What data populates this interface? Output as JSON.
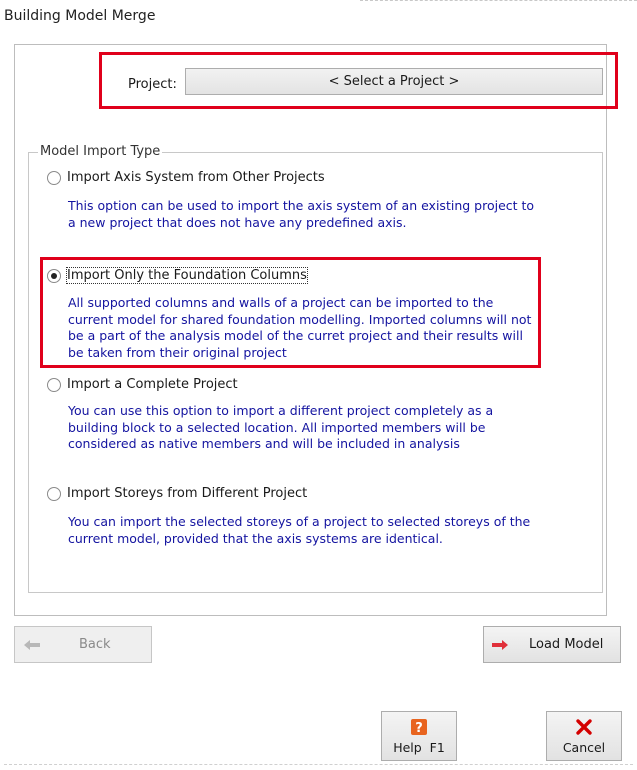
{
  "window": {
    "title": "Building Model Merge"
  },
  "project": {
    "label": "Project:",
    "button_text": "< Select a Project >"
  },
  "import_type": {
    "group_title": "Model Import Type",
    "options": [
      {
        "label": "Import Axis System from Other Projects",
        "selected": false,
        "description": "This option can be used to import the axis system of an existing project to a new project that does not have any predefined axis."
      },
      {
        "label": "Import Only the Foundation Columns",
        "selected": true,
        "description": "All supported columns and walls of a project can be imported to the current model for shared foundation modelling. Imported columns will not be a part of the analysis model of the curret project and their results will be taken from their original project"
      },
      {
        "label": "Import a Complete Project",
        "selected": false,
        "description": "You can use this option to import a different project completely as a building block to a selected location. All imported members will be considered as native members and will be included in analysis"
      },
      {
        "label": "Import Storeys from Different Project",
        "selected": false,
        "description": "You can import the selected storeys of a project to selected storeys of the current model, provided that the axis systems are identical."
      }
    ]
  },
  "nav": {
    "back_label": "Back",
    "back_enabled": false,
    "load_label": "Load Model"
  },
  "footer": {
    "help_label": "Help  F1",
    "cancel_label": "Cancel"
  },
  "colors": {
    "highlight": "#e0001b",
    "description_text": "#1414a0",
    "cancel_x": "#d40000",
    "help_icon": "#e8641f",
    "arrow": "#e0303a"
  },
  "icons": {
    "back": "left-arrow-icon",
    "load": "right-arrow-icon",
    "help": "help-question-icon",
    "cancel": "red-x-icon"
  }
}
